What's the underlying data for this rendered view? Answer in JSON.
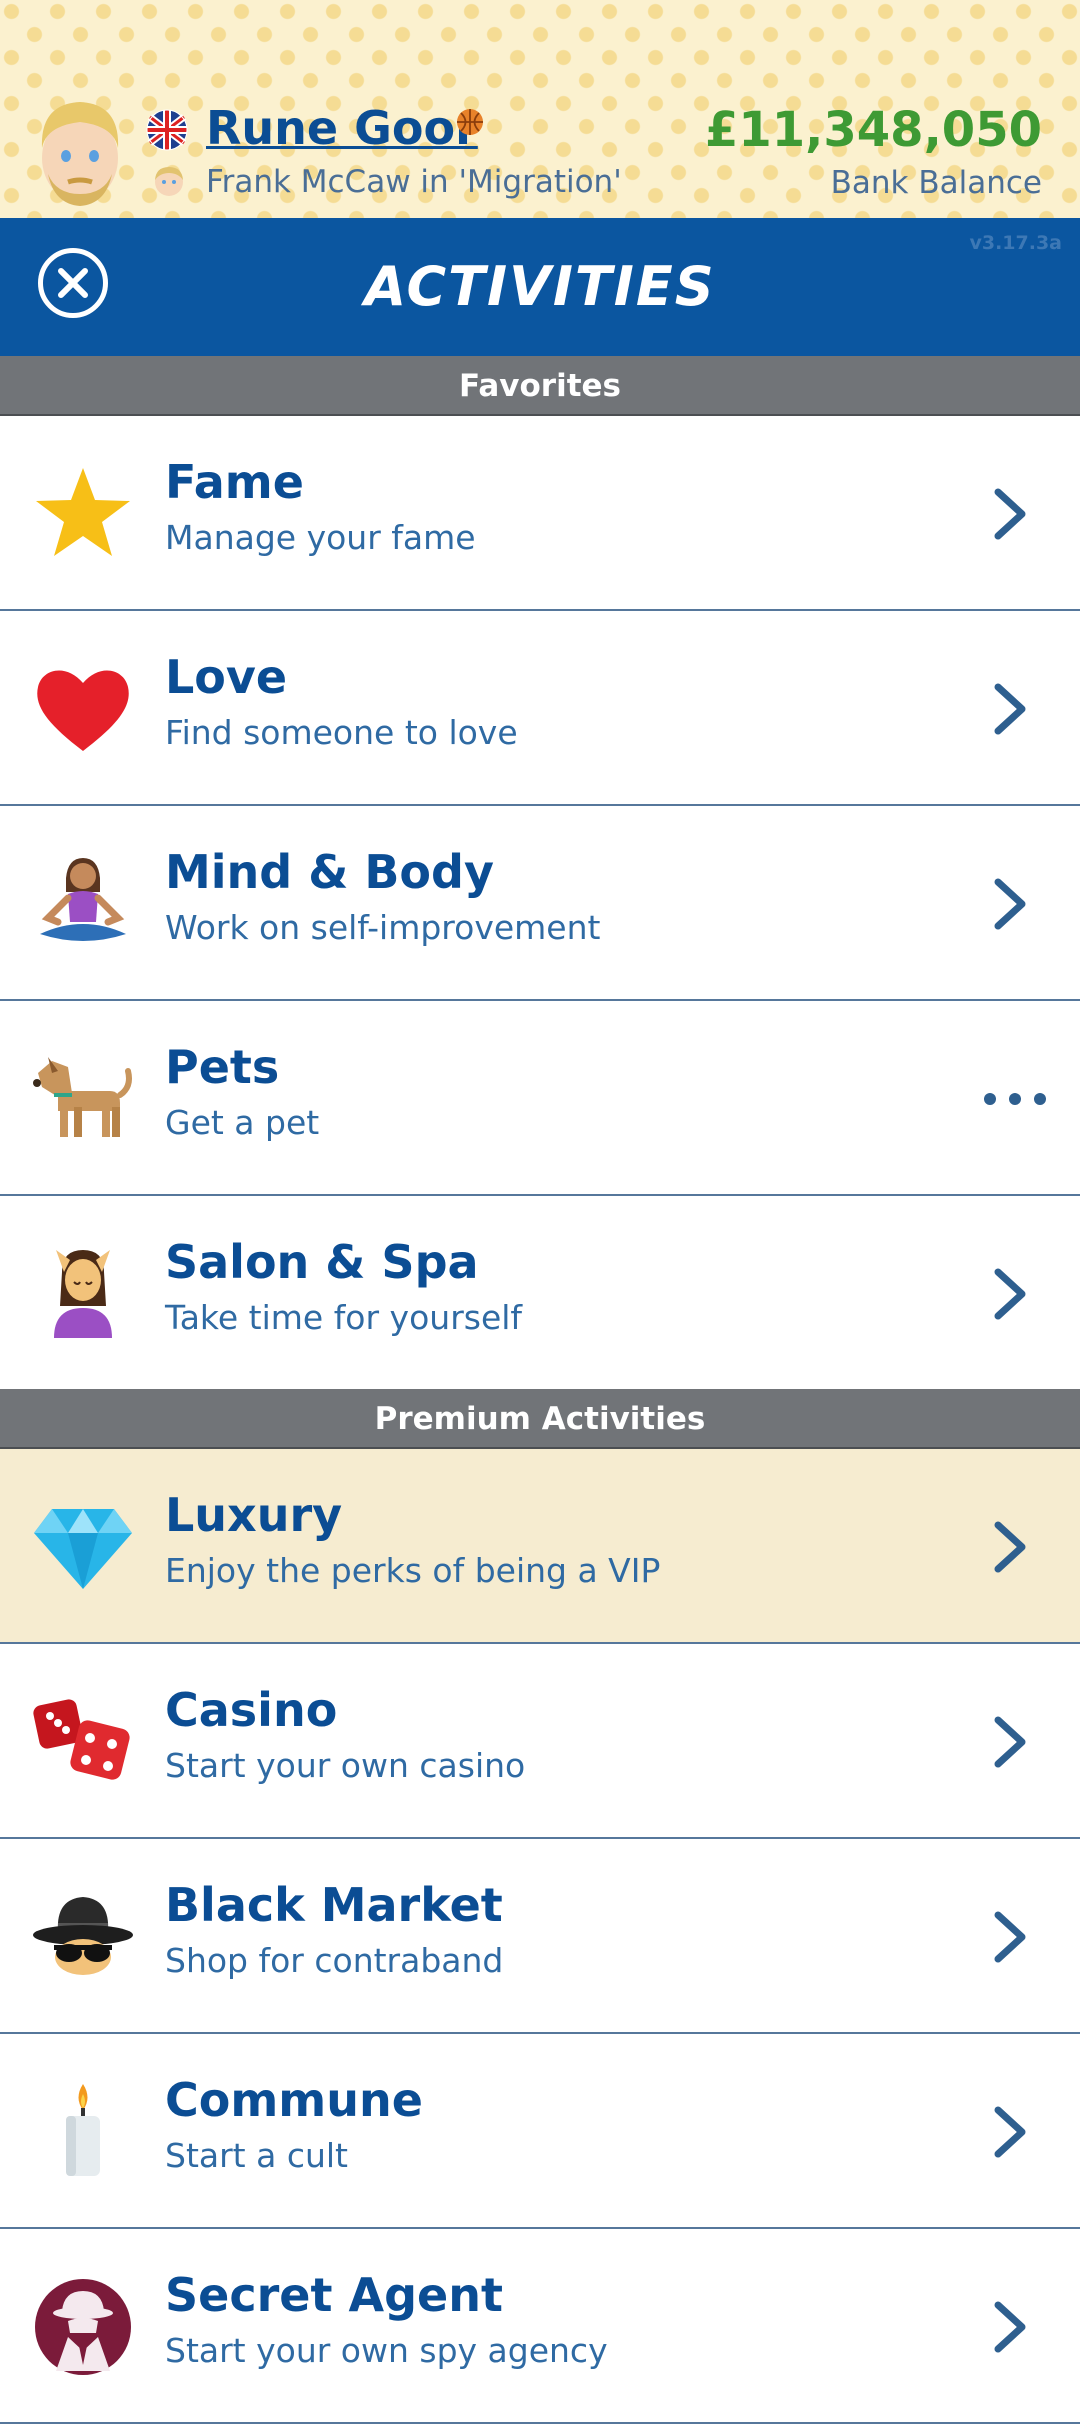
{
  "profile": {
    "name": "Rune Goor",
    "flag_icon": "uk-flag-icon",
    "badge_icon": "basketball-icon",
    "spouse_line": "Frank McCaw in 'Migration'",
    "balance": "£11,348,050",
    "balance_label": "Bank Balance"
  },
  "header": {
    "title": "ACTIVITIES",
    "version": "v3.17.3a",
    "close_icon": "close-icon"
  },
  "sections": {
    "favorites": "Favorites",
    "premium": "Premium Activities"
  },
  "favorites": [
    {
      "title": "Fame",
      "subtitle": "Manage your fame",
      "icon": "star-icon"
    },
    {
      "title": "Love",
      "subtitle": "Find someone to love",
      "icon": "heart-icon"
    },
    {
      "title": "Mind & Body",
      "subtitle": "Work on self-improvement",
      "icon": "meditation-icon"
    },
    {
      "title": "Pets",
      "subtitle": "Get a pet",
      "icon": "dog-icon"
    },
    {
      "title": "Salon & Spa",
      "subtitle": "Take time for yourself",
      "icon": "massage-icon"
    }
  ],
  "premium": [
    {
      "title": "Luxury",
      "subtitle": "Enjoy the perks of being a VIP",
      "icon": "diamond-icon"
    },
    {
      "title": "Casino",
      "subtitle": "Start your own casino",
      "icon": "dice-icon"
    },
    {
      "title": "Black Market",
      "subtitle": "Shop for contraband",
      "icon": "spy-hat-icon"
    },
    {
      "title": "Commune",
      "subtitle": "Start a cult",
      "icon": "candle-icon"
    },
    {
      "title": "Secret Agent",
      "subtitle": "Start your own spy agency",
      "icon": "detective-icon"
    }
  ],
  "colors": {
    "brand_blue": "#0b56a0",
    "balance_green": "#3e9a34",
    "premium_row": "#f6ecd0",
    "section_gray": "#717478"
  }
}
